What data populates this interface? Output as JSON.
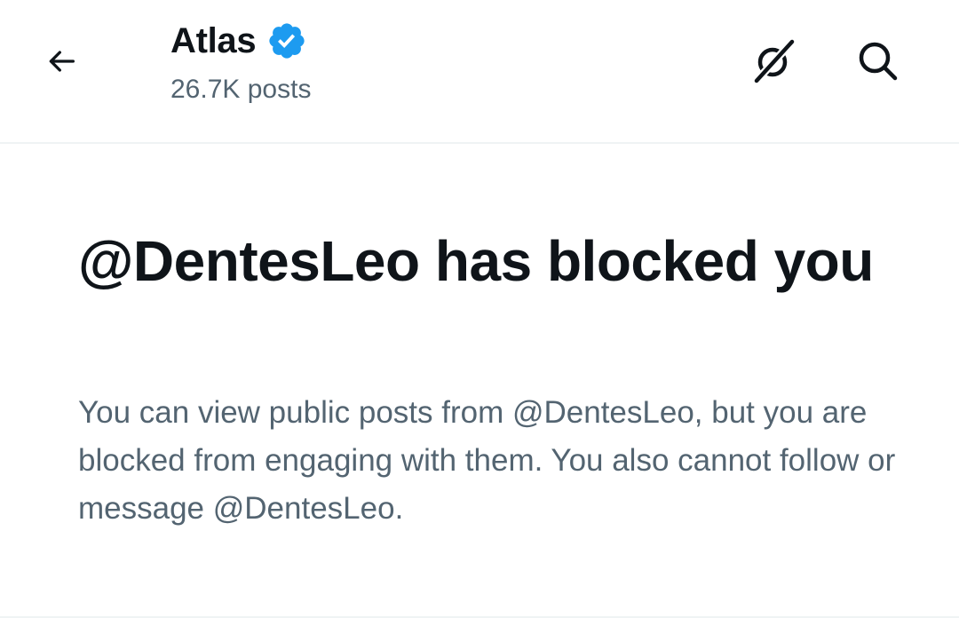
{
  "header": {
    "title": "Atlas",
    "posts_count": "26.7K posts",
    "verified": true,
    "icons": {
      "back": "arrow-left-icon",
      "grok": "grok-icon",
      "search": "search-icon"
    }
  },
  "blocked": {
    "title": "@DentesLeo has blocked you",
    "description": "You can view public posts from @DentesLeo, but you are blocked from engaging with them. You also cannot follow or message @DentesLeo."
  },
  "colors": {
    "text_primary": "#0f1419",
    "text_secondary": "#536471",
    "verified_blue": "#1d9bf0",
    "divider": "#eff3f4"
  }
}
